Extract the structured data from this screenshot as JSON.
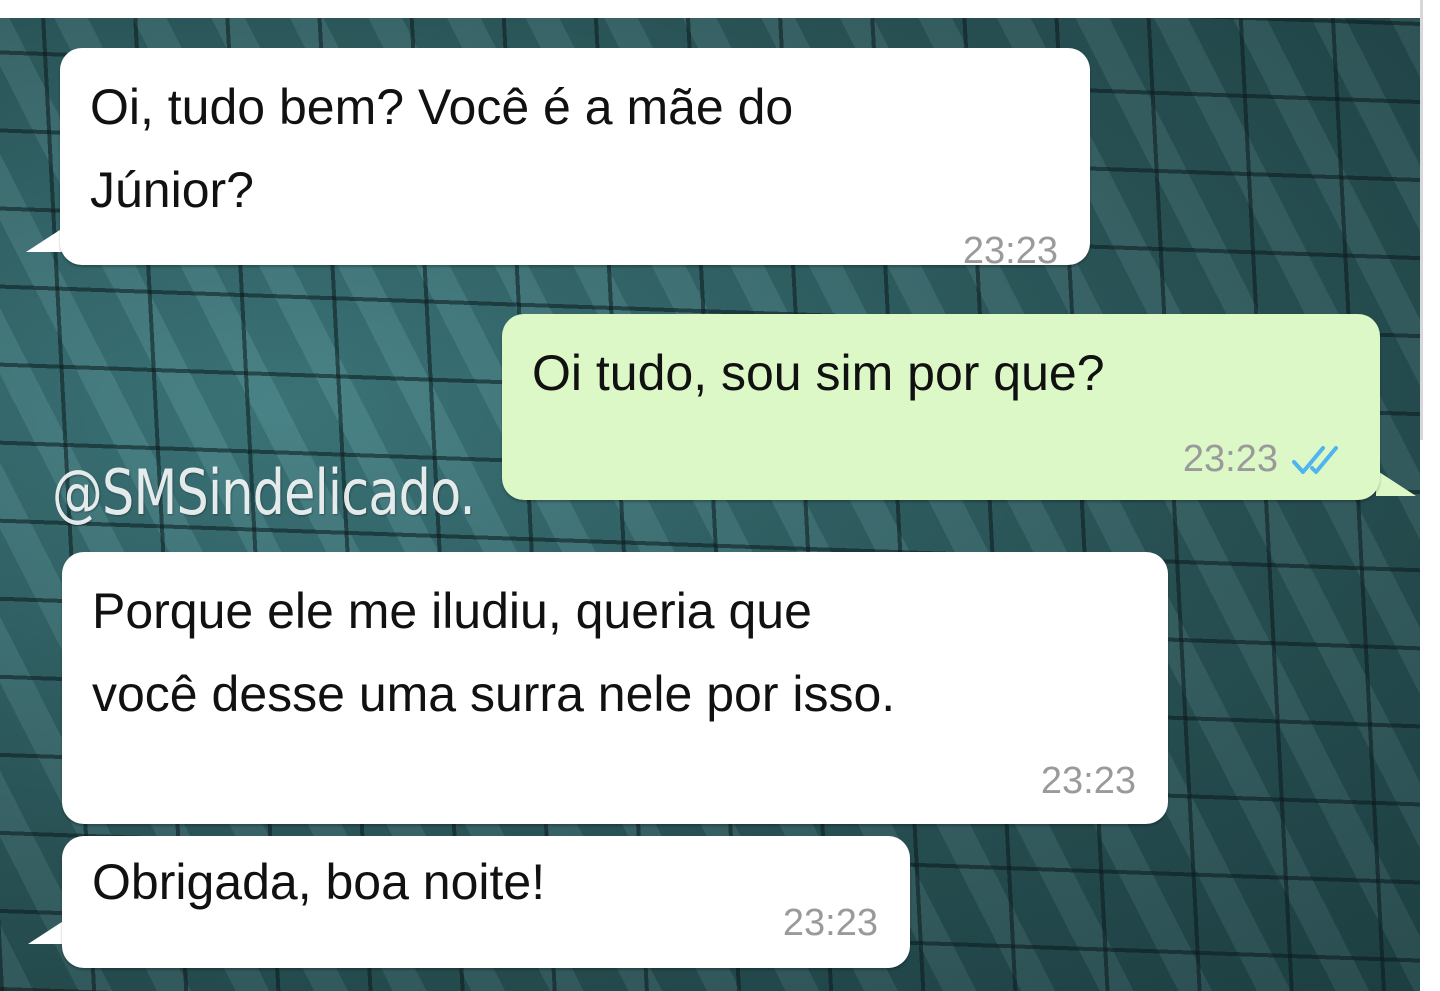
{
  "chat": {
    "watermark": "@SMSindelicado.",
    "messages": [
      {
        "direction": "incoming",
        "text": "Oi, tudo bem? Você é a mãe do\nJúnior?",
        "time": "23:23"
      },
      {
        "direction": "outgoing",
        "text": "Oi tudo, sou sim por que?",
        "time": "23:23",
        "status": "read-double-check-icon"
      },
      {
        "direction": "incoming",
        "text": "Porque ele me iludiu, queria que\nvocê desse uma surra nele por isso.",
        "time": "23:23"
      },
      {
        "direction": "incoming",
        "text": "Obrigada, boa noite!",
        "time": "23:23"
      }
    ]
  },
  "colors": {
    "incoming_bubble": "#ffffff",
    "outgoing_bubble": "#dcf8c6",
    "read_ticks": "#4fb4f0",
    "timestamp": "#9a9a9a"
  }
}
